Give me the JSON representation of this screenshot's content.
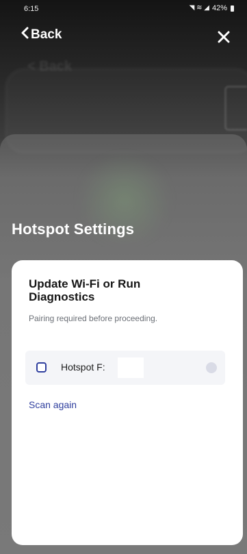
{
  "status_bar": {
    "time": "6:15",
    "signal_glyphs": "◥ ≋ ◢",
    "battery_percent": "42%"
  },
  "nav": {
    "back_icon": "chevron-left-icon",
    "back_label": "Back",
    "close_icon": "close-icon",
    "close_glyph": "✕"
  },
  "page": {
    "title": "Hotspot Settings"
  },
  "card": {
    "title": "Update Wi-Fi or Run Diagnostics",
    "subtitle": "Pairing required before proceeding.",
    "device": {
      "label": "Hotspot F:",
      "checkbox_icon": "checkbox-icon",
      "status_indicator_color": "#d9dbe6"
    },
    "scan_again_label": "Scan again"
  },
  "colors": {
    "accent": "#2f3f9e",
    "card_background": "#ffffff",
    "device_row_background": "#f4f5f8",
    "subtitle_text": "#6b6f76"
  }
}
